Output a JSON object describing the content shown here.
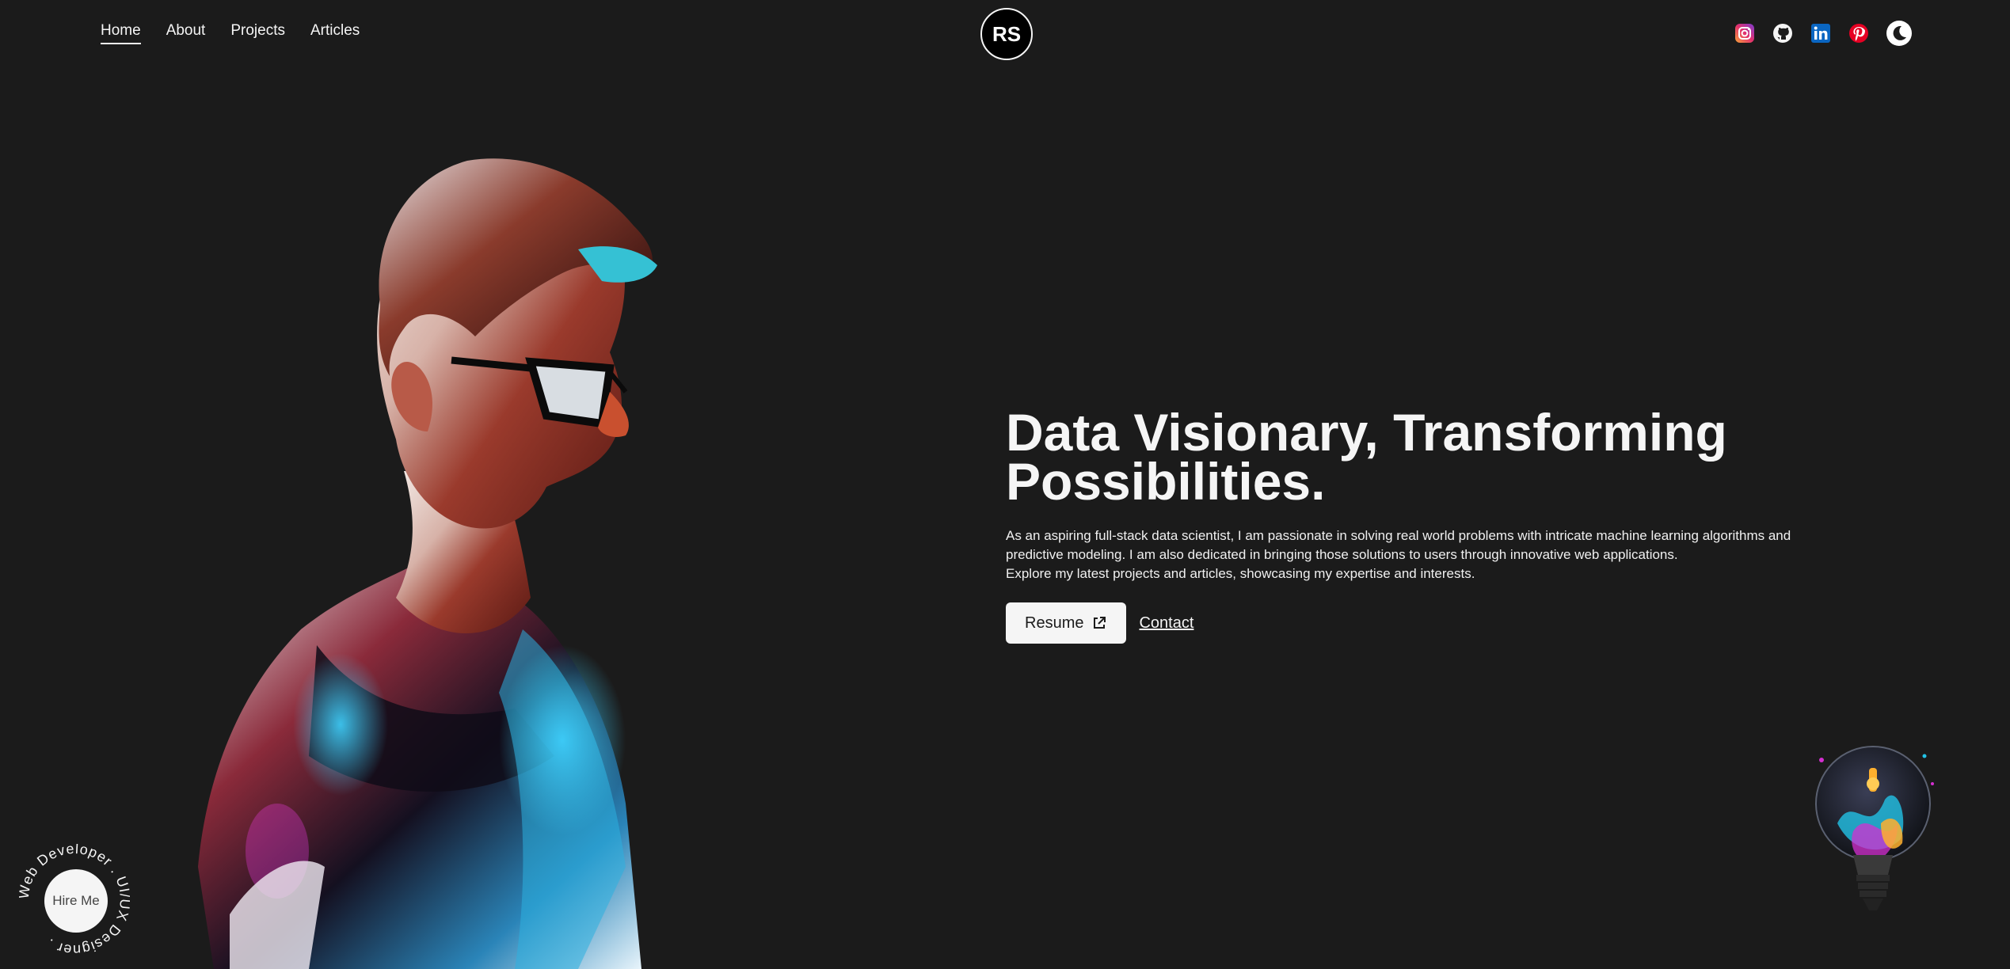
{
  "nav": {
    "items": [
      "Home",
      "About",
      "Projects",
      "Articles"
    ]
  },
  "logo": {
    "text": "RS"
  },
  "socials": [
    "instagram-icon",
    "github-icon",
    "linkedin-icon",
    "pinterest-icon",
    "moon-icon"
  ],
  "hero": {
    "title_line1": "Data Visionary, Transforming",
    "title_line2": "Possibilities.",
    "paragraph_line1": "As an aspiring full-stack data scientist, I am passionate in solving real world problems with intricate machine learning algorithms and",
    "paragraph_line2": "predictive modeling. I am also dedicated in bringing those solutions to users through innovative web applications.",
    "paragraph_line3": "Explore my latest projects and articles, showcasing my expertise and interests.",
    "resume_label": "Resume",
    "contact_label": "Contact"
  },
  "hire": {
    "label": "Hire Me",
    "ring_text": "Web Developer . UI/UX Designer ."
  },
  "colors": {
    "background": "#1b1b1b",
    "text": "#f5f5f5"
  }
}
